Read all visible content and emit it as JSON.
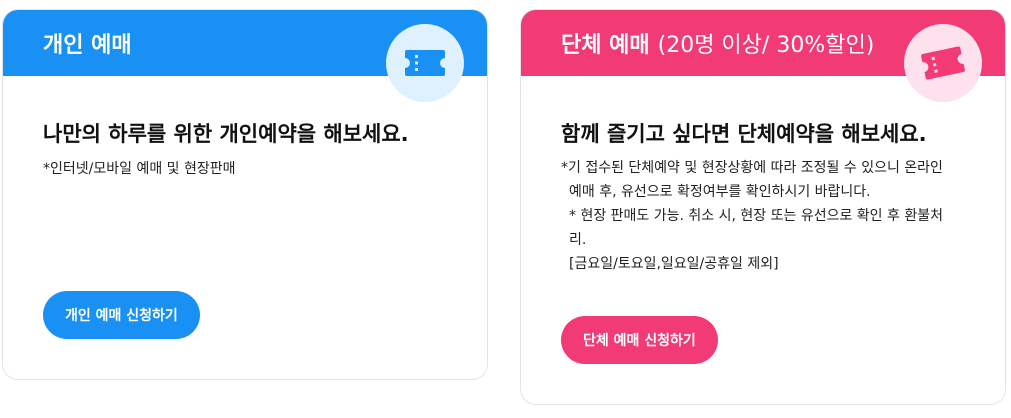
{
  "individual": {
    "title": "개인 예매",
    "icon": "ticket-icon",
    "heading": "나만의 하루를 위한 개인예약을 해보세요.",
    "note": "*인터넷/모바일 예매 및 현장판매",
    "button_label": "개인 예매 신청하기",
    "accent": "#1890f4",
    "icon_bg": "#dff0fe"
  },
  "group": {
    "title": "단체 예매",
    "subtitle": "(20명 이상/ 30%할인)",
    "icon": "ticket-icon",
    "heading": "함께 즐기고 싶다면 단체예약을 해보세요.",
    "notes": [
      "*기 접수된 단체예약 및 현장상황에 따라 조정될 수 있으니 온라인",
      "예매 후, 유선으로 확정여부를 확인하시기 바랍니다.",
      "* 현장 판매도 가능. 취소 시, 현장 또는 유선으로 확인 후 환불처",
      "리.",
      "[금요일/토요일,일요일/공휴일 제외]"
    ],
    "button_label": "단체 예매 신청하기",
    "accent": "#f23a75",
    "icon_bg": "#fde1ec"
  }
}
